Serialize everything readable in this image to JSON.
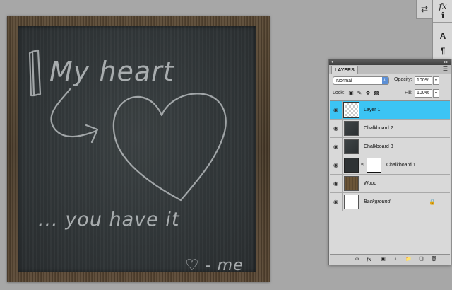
{
  "canvas": {
    "chalk_text_line1": "My heart",
    "chalk_text_line2": "... you have it",
    "chalk_text_line3": "♡ - me"
  },
  "right_toolbar": {
    "items": [
      {
        "icon": "fx-icon",
        "glyph": "fx"
      },
      {
        "icon": "info-icon",
        "glyph": "ℹ"
      },
      {
        "icon": "character-icon",
        "glyph": "A"
      },
      {
        "icon": "paragraph-icon",
        "glyph": "¶"
      }
    ],
    "mini_icon": "⇄"
  },
  "layers_panel": {
    "tab_label": "LAYERS",
    "blend_mode": "Normal",
    "opacity_label": "Opacity:",
    "opacity_value": "100%",
    "lock_label": "Lock:",
    "fill_label": "Fill:",
    "fill_value": "100%",
    "layers": [
      {
        "name": "Layer 1",
        "selected": true,
        "thumb": "checker"
      },
      {
        "name": "Chalkboard 2",
        "selected": false,
        "thumb": "dark"
      },
      {
        "name": "Chalkboard 3",
        "selected": false,
        "thumb": "dark"
      },
      {
        "name": "Chalkboard 1",
        "selected": false,
        "thumb": "dark-solid",
        "has_mask": true
      },
      {
        "name": "Wood",
        "selected": false,
        "thumb": "wood"
      },
      {
        "name": "Background",
        "selected": false,
        "thumb": "white",
        "italic": true,
        "locked": true
      }
    ],
    "colors": {
      "selected_row": "#3cc4f4",
      "panel_bg": "#d6d6d6"
    }
  }
}
